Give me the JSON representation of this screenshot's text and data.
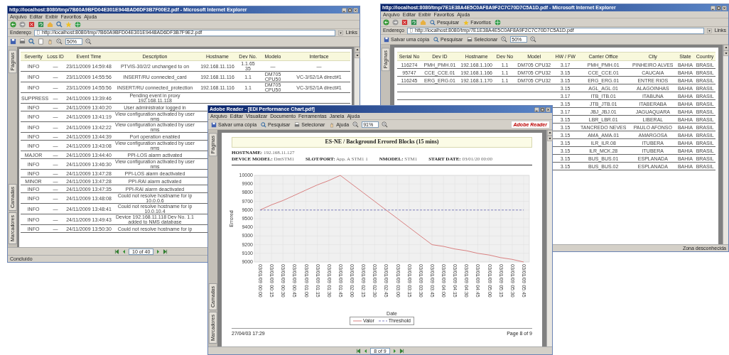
{
  "windows": [
    {
      "kind": "browser",
      "title": "http://localhost:8080/tmp/7B60A9BFD04E301E9448AD6DF3B7F00E2.pdf - Microsoft Internet Explorer",
      "menu": [
        "Arquivo",
        "Editar",
        "Exibir",
        "Favoritos",
        "Ajuda"
      ],
      "address_label": "Endereço",
      "address": "http://localhost:8080/tmp/7B60A9BFD04E301E9448AD6DF3B7F9E2.pdf",
      "links": "Links",
      "zoom": "50%",
      "side_tabs": [
        "Páginas"
      ],
      "lower_tabs": [
        "Camadas",
        "Marcadores"
      ],
      "table": {
        "columns": [
          "Severity",
          "Loss ID",
          "Event Time",
          "Description",
          "Hostname",
          "Dev No.",
          "Modelo",
          "Interface"
        ],
        "rows": [
          [
            "INFO",
            "—",
            "23/11/2009 14:59:48",
            "PTVIS-30/2/2 unchanged to on",
            "192.168.11.116",
            "1.1.65 35",
            "—",
            "—"
          ],
          [
            "INFO",
            "—",
            "23/11/2009 14:55:56",
            "INSERT/RU connected_card",
            "192.168.11.116",
            "1.1",
            "DM705 CPU50",
            "VC-3/S2/1A direct#1"
          ],
          [
            "INFO",
            "—",
            "23/11/2009 14:55:56",
            "INSERT/RU connected_protection",
            "192.168.11.116",
            "1.1",
            "DM705 CPU50",
            "VC-3/S2/1A direct#1"
          ],
          [
            "SUPPRESS",
            "—",
            "24/11/2009 13:39:46",
            "Pending event in proxy 192.168.11.118"
          ],
          [
            "INFO",
            "—",
            "24/11/2009 13:40:20",
            "User administrator logged in"
          ],
          [
            "INFO",
            "—",
            "24/11/2009 13:41:19",
            "View configuration activated by user nms"
          ],
          [
            "INFO",
            "—",
            "24/11/2009 13:42:22",
            "View configuration activated by user nms"
          ],
          [
            "INFO",
            "—",
            "24/11/2009 13:44:39",
            "Port operation enabled"
          ],
          [
            "INFO",
            "—",
            "24/11/2009 13:43:08",
            "View configuration activated by user nms"
          ],
          [
            "MAJOR",
            "—",
            "24/11/2009 13:44:40",
            "PPI-LOS alarm activated"
          ],
          [
            "INFO",
            "—",
            "24/11/2009 13:46:30",
            "View configuration activated by user nms"
          ],
          [
            "INFO",
            "—",
            "24/11/2009 13:47:28",
            "PPI-LOS alarm deactivated"
          ],
          [
            "MINOR",
            "—",
            "24/11/2009 13:47:28",
            "PPI-RAI alarm activated"
          ],
          [
            "INFO",
            "—",
            "24/11/2009 13:47:35",
            "PPI-RAI alarm deactivated"
          ],
          [
            "INFO",
            "—",
            "24/11/2009 13:48:08",
            "Could not resolve hostname for ip 10.0.0.6"
          ],
          [
            "INFO",
            "—",
            "24/11/2009 13:48:41",
            "Could not resolve hostname for ip 10.0.10.4"
          ],
          [
            "INFO",
            "—",
            "24/11/2009 13:49:43",
            "Device 192.168.11.118 Dev No. 1.1 added to NMS database"
          ],
          [
            "INFO",
            "—",
            "24/11/2009 13:50:30",
            "Could not resolve hostname for ip"
          ]
        ]
      },
      "page_field": "10 of 40",
      "status": "Concluído"
    },
    {
      "kind": "browser",
      "title": "http://localhost:8080/tmp/7E1E38A4E5C0AF8A9F2C7C70D7C5A1D.pdf - Microsoft Internet Explorer",
      "menu": [
        "Arquivo",
        "Editar",
        "Exibir",
        "Favoritos",
        "Ajuda"
      ],
      "nav_buttons": [
        "Pesquisar",
        "Favoritos"
      ],
      "address_label": "Endereço",
      "address": "http://localhost:8080/tmp/7E1E38A4E5C0AF8A9F2C7C70D7C5A1D.pdf",
      "links": "Links",
      "reader_buttons": [
        "Salvar uma cópia",
        "Pesquisar",
        "Selecionar"
      ],
      "zoom": "50%",
      "side_tabs": [
        "Páginas"
      ],
      "table": {
        "columns": [
          "Serial No",
          "Dev ID",
          "Hostname",
          "Dev No",
          "Model",
          "HW / FW",
          "Carrier Office",
          "City",
          "State",
          "Country"
        ],
        "rows": [
          [
            "116274",
            "PMH_PMH.01",
            "192.168.1.100",
            "1.1",
            "DM705 CPU32",
            "3.17",
            "PMH_PMH.01",
            "PINHEIRO ALVES",
            "BAHIA",
            "BRASIL"
          ],
          [
            "95747",
            "CCE_CCE.01",
            "192.168.1.166",
            "1.1",
            "DM705 CPU32",
            "3.15",
            "CCE_CCE.01",
            "CAUCAIA",
            "BAHIA",
            "BRASIL"
          ],
          [
            "116245",
            "ERG_ERG.01",
            "192.168.1.170",
            "1.1",
            "DM705 CPU32",
            "3.15",
            "ERG_ERG.01",
            "ENTRE RIOS",
            "BAHIA",
            "BRASIL"
          ],
          [
            null,
            null,
            null,
            null,
            null,
            "3.15",
            "AGL_AGL.01",
            "ALAGOINHAS",
            "BAHIA",
            "BRASIL"
          ],
          [
            null,
            null,
            null,
            null,
            null,
            "3.17",
            "ITB_ITB.01",
            "ITABUNA",
            "BAHIA",
            "BRASIL"
          ],
          [
            null,
            null,
            null,
            null,
            null,
            "3.15",
            "JTB_JTB.01",
            "ITABERABA",
            "BAHIA",
            "BRASIL"
          ],
          [
            null,
            null,
            null,
            null,
            null,
            "3.17",
            "JBJ_JBJ.01",
            "JAGUAQUARA",
            "BAHIA",
            "BRASIL"
          ],
          [
            null,
            null,
            null,
            null,
            null,
            "3.15",
            "LBR_LBR.01",
            "LIBERAL",
            "BAHIA",
            "BRASIL"
          ],
          [
            null,
            null,
            null,
            null,
            null,
            "3.15",
            "TANCREDO NEVES",
            "PAULO AFONSO",
            "BAHIA",
            "BRASIL"
          ],
          [
            null,
            null,
            null,
            null,
            null,
            "3.15",
            "AMA_AMA.01",
            "AMARGOSA",
            "BAHIA",
            "BRASIL"
          ],
          [
            null,
            null,
            null,
            null,
            null,
            "3.15",
            "ILR_ILR.08",
            "ITUBERA",
            "BAHIA",
            "BRASIL"
          ],
          [
            null,
            null,
            null,
            null,
            null,
            "3.15",
            "ILR_MCK.28",
            "ITUBERA",
            "BAHIA",
            "BRASIL"
          ],
          [
            null,
            null,
            null,
            null,
            null,
            "3.15",
            "BUS_BUS.01",
            "ESPLANADA",
            "BAHIA",
            "BRASIL"
          ],
          [
            null,
            null,
            null,
            null,
            null,
            "3.15",
            "BUS_BUS.02",
            "ESPLANADA",
            "BAHIA",
            "BRASIL"
          ]
        ]
      },
      "status": "Zona desconhecida"
    },
    {
      "kind": "reader",
      "title": "Adobe Reader - [EDI Performance Chart.pdf]",
      "menu": [
        "Arquivo",
        "Editar",
        "Visualizar",
        "Documento",
        "Ferramentas",
        "Janela",
        "Ajuda"
      ],
      "reader_buttons": [
        "Salvar uma cópia",
        "Pesquisar",
        "Selecionar",
        "Ajuda"
      ],
      "zoom": "91%",
      "brand": "Adobe Reader",
      "side_tabs": [
        "Páginas"
      ],
      "lower_tabs": [
        "Camadas",
        "Marcadores"
      ],
      "report": {
        "title": "ES-NE / Background Errored Blocks (15 mins)",
        "hostname_label": "HOSTNAME:",
        "hostname": "192.168.11.127",
        "fields": [
          {
            "label": "DEVICE MODEL:",
            "value": "DmSTM1"
          },
          {
            "label": "SLOT/PORT:",
            "value": "App. A STM1 1"
          },
          {
            "label": "NMODEL:",
            "value": "STM1"
          },
          {
            "label": "START DATE:",
            "value": "03/01/20 00:00"
          }
        ],
        "chart_data": {
          "type": "line",
          "grid": true,
          "xlabel": "Date",
          "ylabel": "Errored",
          "ylim": [
            9000,
            10000
          ],
          "yticks": [
            9000,
            9100,
            9200,
            9300,
            9400,
            9500,
            9600,
            9700,
            9800,
            9900,
            10000
          ],
          "categories": [
            "03/01/09 00:00",
            "03/01/09 00:15",
            "03/01/09 00:30",
            "03/01/09 00:45",
            "03/01/09 01:00",
            "03/01/09 01:15",
            "03/01/09 01:30",
            "03/01/09 01:45",
            "03/01/09 02:00",
            "03/01/09 02:15",
            "03/01/09 02:30",
            "03/01/09 02:45",
            "03/01/09 03:00",
            "03/01/09 03:15",
            "03/01/09 03:30",
            "03/01/09 03:45",
            "03/01/09 04:00",
            "03/01/09 04:15",
            "03/01/09 04:30",
            "03/01/09 04:45",
            "03/01/09 05:00",
            "03/01/09 05:15",
            "03/01/09 05:30",
            "03/01/09 05:45"
          ],
          "series": [
            {
              "name": "Valor",
              "color": "#d98080",
              "line_style": "solid",
              "values": [
                9600,
                9660,
                9710,
                9770,
                9830,
                9890,
                9940,
                10000,
                9900,
                9800,
                9700,
                9600,
                9500,
                9400,
                9300,
                9200,
                9180,
                9150,
                9130,
                9100,
                9080,
                9050,
                9030,
                9000
              ]
            },
            {
              "name": "Threshold",
              "color": "#7f7fbf",
              "line_style": "dashed",
              "values": [
                9600,
                9600,
                9600,
                9600,
                9600,
                9600,
                9600,
                9600,
                9600,
                9600,
                9600,
                9600,
                9600,
                9600,
                9600,
                9600,
                9600,
                9600,
                9600,
                9600,
                9600,
                9600,
                9600,
                9600
              ]
            }
          ]
        },
        "footer_left": "27/04/03 17:29",
        "footer_right": "Page 8 of 9"
      },
      "page_field": "8 of 9"
    }
  ]
}
